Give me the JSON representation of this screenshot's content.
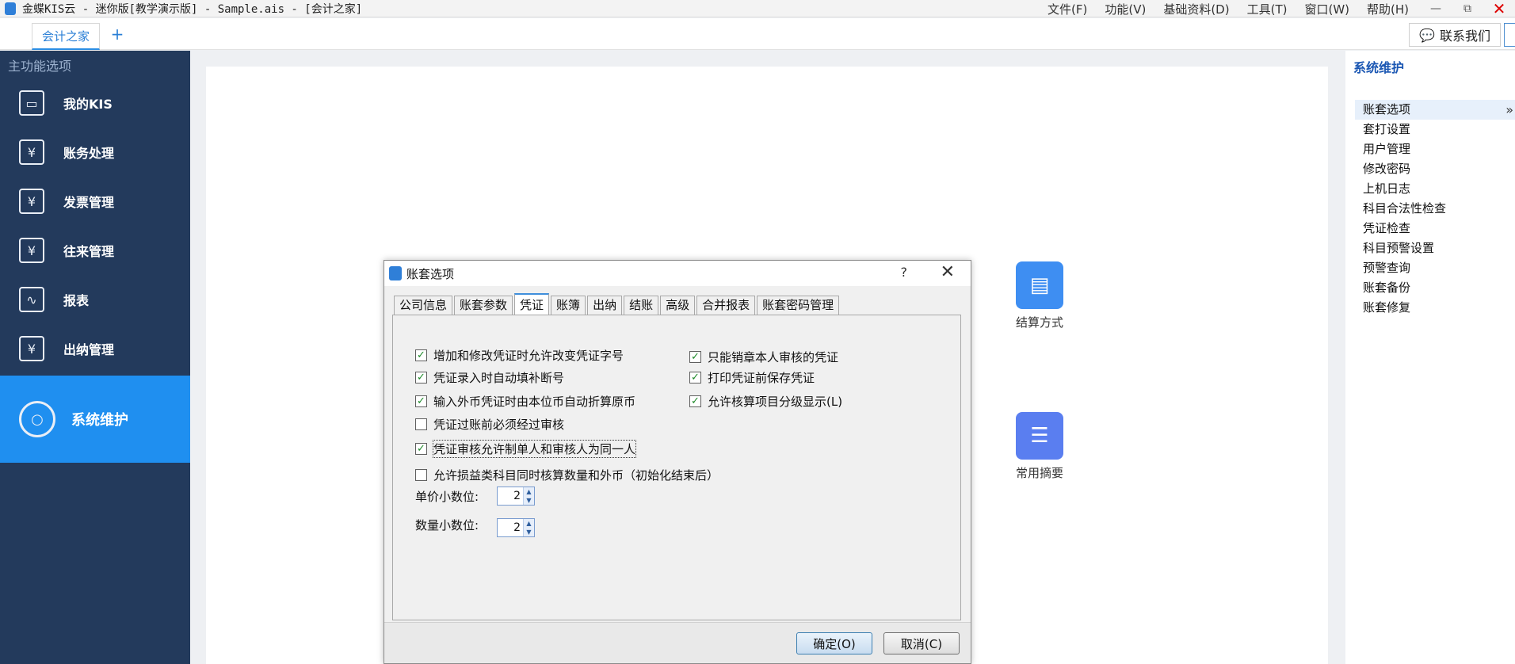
{
  "window": {
    "title": "金蝶KIS云 - 迷你版[教学演示版] - Sample.ais - [会计之家]",
    "menu": [
      "文件(F)",
      "功能(V)",
      "基础资料(D)",
      "工具(T)",
      "窗口(W)",
      "帮助(H)"
    ],
    "controls": {
      "minimize": "—",
      "restore": "⧉",
      "close": "✕"
    }
  },
  "tabbar": {
    "tab_label": "会计之家",
    "add_icon": "+",
    "contact_label": "联系我们",
    "contact_icon": "💬"
  },
  "sidebar": {
    "title": "主功能选项",
    "items": [
      {
        "label": "我的KIS",
        "icon": "monitor-icon",
        "glyph": "▭"
      },
      {
        "label": "账务处理",
        "icon": "ledger-icon",
        "glyph": "¥"
      },
      {
        "label": "发票管理",
        "icon": "invoice-icon",
        "glyph": "¥"
      },
      {
        "label": "往来管理",
        "icon": "transactions-icon",
        "glyph": "¥"
      },
      {
        "label": "报表",
        "icon": "report-icon",
        "glyph": "∿"
      },
      {
        "label": "出纳管理",
        "icon": "cashier-icon",
        "glyph": "¥"
      },
      {
        "label": "系统维护",
        "icon": "system-maintenance-icon",
        "glyph": "○"
      }
    ]
  },
  "shortcuts": [
    {
      "label": "结算方式",
      "icon": "settlement-icon",
      "glyph": "▤"
    },
    {
      "label": "常用摘要",
      "icon": "summary-icon",
      "glyph": "☰"
    }
  ],
  "right_panel": {
    "title": "系统维护",
    "items": [
      "账套选项",
      "套打设置",
      "用户管理",
      "修改密码",
      "上机日志",
      "科目合法性检查",
      "凭证检查",
      "科目预警设置",
      "预警查询",
      "账套备份",
      "账套修复"
    ],
    "selected_arrow": "»"
  },
  "dialog": {
    "title": "账套选项",
    "help": "?",
    "close": "✕",
    "tabs": [
      "公司信息",
      "账套参数",
      "凭证",
      "账簿",
      "出纳",
      "结账",
      "高级",
      "合并报表",
      "账套密码管理"
    ],
    "active_tab": "凭证",
    "checkboxes": [
      {
        "label": "增加和修改凭证时允许改变凭证字号",
        "checked": true
      },
      {
        "label": "只能销章本人审核的凭证",
        "checked": true
      },
      {
        "label": "凭证录入时自动填补断号",
        "checked": true
      },
      {
        "label": "打印凭证前保存凭证",
        "checked": true
      },
      {
        "label": "输入外币凭证时由本位币自动折算原币",
        "checked": true
      },
      {
        "label": "允许核算项目分级显示(L)",
        "checked": true
      },
      {
        "label": "凭证过账前必须经过审核",
        "checked": false
      },
      {
        "label": "凭证审核允许制单人和审核人为同一人",
        "checked": true
      },
      {
        "label": "允许损益类科目同时核算数量和外币（初始化结束后）",
        "checked": false
      }
    ],
    "check_mark": "✓",
    "unit_price_decimals_label": "单价小数位:",
    "unit_price_decimals": "2",
    "quantity_decimals_label": "数量小数位:",
    "quantity_decimals": "2",
    "ok_label": "确定(O)",
    "cancel_label": "取消(C)"
  }
}
